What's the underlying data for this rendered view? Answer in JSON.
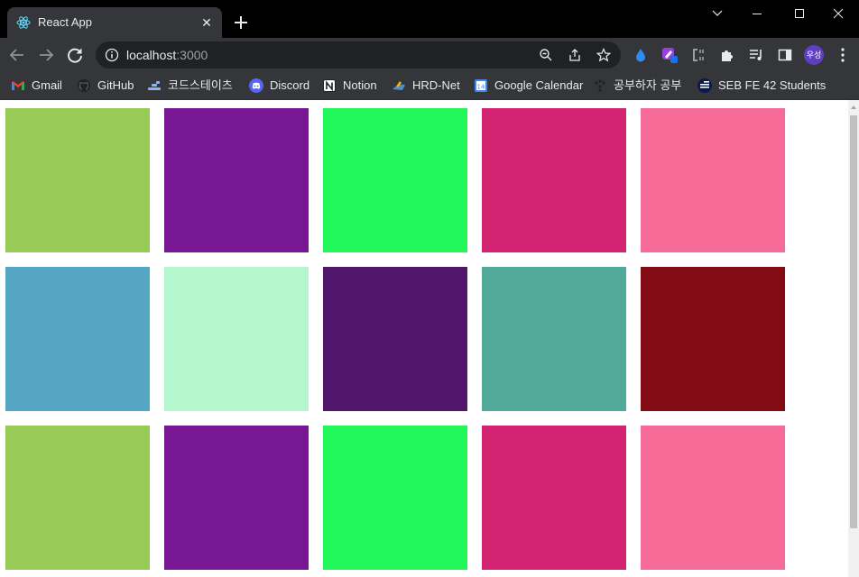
{
  "tab": {
    "title": "React App",
    "close_glyph": "✕"
  },
  "window": {
    "controls": [
      "chevron-down-icon",
      "minimize-icon",
      "maximize-icon",
      "close-icon"
    ]
  },
  "omnibox": {
    "host": "localhost",
    "port": ":3000"
  },
  "profile": {
    "initials": "우성"
  },
  "bookmarks": [
    {
      "label": "Gmail",
      "icon": "gmail-icon",
      "color": "#ea4335"
    },
    {
      "label": "GitHub",
      "icon": "github-icon",
      "color": "#ffffff"
    },
    {
      "label": "코드스테이츠",
      "icon": "codestates-icon",
      "color": "#8ab4f8"
    },
    {
      "label": "Discord",
      "icon": "discord-icon",
      "color": "#5865f2"
    },
    {
      "label": "Notion",
      "icon": "notion-icon",
      "color": "#ffffff"
    },
    {
      "label": "HRD-Net",
      "icon": "hrdnet-icon",
      "color": "#4a90d9"
    },
    {
      "label": "Google Calendar",
      "icon": "calendar-icon",
      "color": "#4285f4"
    },
    {
      "label": "공부하자 공부",
      "icon": "dots-icon",
      "color": "#9aa0a6"
    },
    {
      "label": "SEB FE 42 Students",
      "icon": "seb-icon",
      "color": "#0b1a4a"
    }
  ],
  "tiles": [
    [
      "#97ca56",
      "#771794",
      "#21f85a",
      "#d22471",
      "#f66b98"
    ],
    [
      "#55a6c2",
      "#b4f7cf",
      "#51176c",
      "#51aa97",
      "#830b14"
    ],
    [
      "#97ca56",
      "#771794",
      "#21f85a",
      "#d22471",
      "#f66b98"
    ]
  ]
}
